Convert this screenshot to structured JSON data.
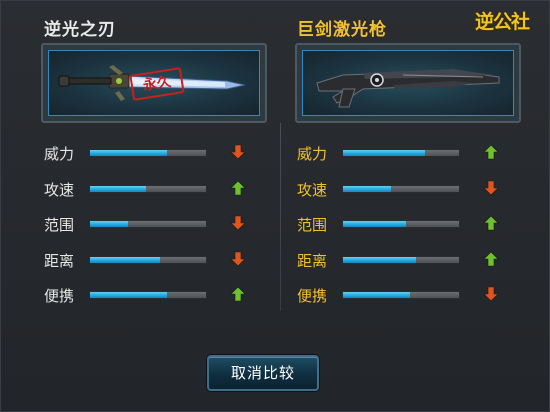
{
  "left_weapon": {
    "name": "逆光之刃",
    "stamp": "永久",
    "stats": [
      {
        "label": "威力",
        "value": 0.66,
        "trend": "down"
      },
      {
        "label": "攻速",
        "value": 0.48,
        "trend": "up"
      },
      {
        "label": "范围",
        "value": 0.33,
        "trend": "down"
      },
      {
        "label": "距离",
        "value": 0.6,
        "trend": "down"
      },
      {
        "label": "便携",
        "value": 0.66,
        "trend": "up"
      }
    ]
  },
  "right_weapon": {
    "name": "巨剑激光枪",
    "stats": [
      {
        "label": "威力",
        "value": 0.71,
        "trend": "up"
      },
      {
        "label": "攻速",
        "value": 0.41,
        "trend": "down"
      },
      {
        "label": "范围",
        "value": 0.54,
        "trend": "up"
      },
      {
        "label": "距离",
        "value": 0.63,
        "trend": "up"
      },
      {
        "label": "便携",
        "value": 0.58,
        "trend": "down"
      }
    ]
  },
  "compare_button_label": "取消比较",
  "logo": {
    "text": "逆公社"
  },
  "colors": {
    "up_arrow": "#6ec12a",
    "down_arrow": "#e0541e",
    "highlight_text": "#f2c030",
    "bar_fill": "#22a6de"
  }
}
